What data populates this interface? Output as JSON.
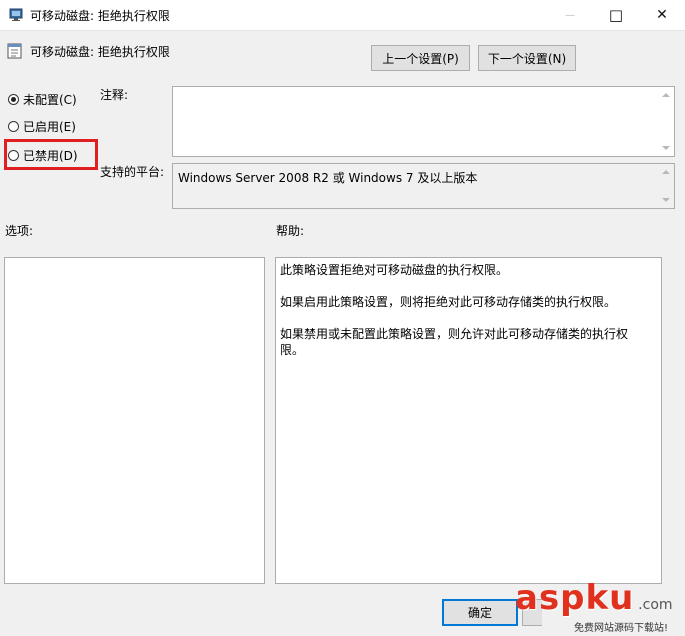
{
  "window": {
    "title": "可移动磁盘: 拒绝执行权限",
    "minimize_glyph": "—",
    "maximize_glyph": "□",
    "close_glyph": "✕"
  },
  "header": {
    "policy_name": "可移动磁盘: 拒绝执行权限",
    "prev_button": "上一个设置(P)",
    "next_button": "下一个设置(N)"
  },
  "state": {
    "options": [
      {
        "label": "未配置(C)",
        "checked": true
      },
      {
        "label": "已启用(E)",
        "checked": false
      },
      {
        "label": "已禁用(D)",
        "checked": false
      }
    ],
    "highlight_color": "#e02020"
  },
  "comment": {
    "label": "注释:",
    "value": ""
  },
  "platform": {
    "label": "支持的平台:",
    "value": "Windows Server 2008 R2 或 Windows 7 及以上版本"
  },
  "options_pane": {
    "label": "选项:"
  },
  "help_pane": {
    "label": "帮助:",
    "paragraphs": [
      "此策略设置拒绝对可移动磁盘的执行权限。",
      "如果启用此策略设置，则将拒绝对此可移动存储类的执行权限。",
      "如果禁用或未配置此策略设置，则允许对此可移动存储类的执行权限。"
    ]
  },
  "footer": {
    "ok_button": "确定"
  },
  "watermark": {
    "brand": "aspku",
    "suffix": ".com",
    "tagline": "免费网站源码下载站!"
  }
}
